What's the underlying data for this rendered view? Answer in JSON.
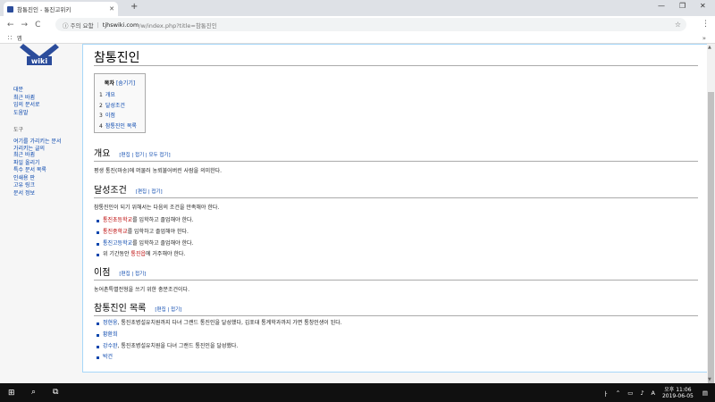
{
  "browser": {
    "tab_title": "참통진인 - 통진고위키",
    "tab_close": "✕",
    "new_tab": "+",
    "back": "←",
    "forward": "→",
    "reload": "C",
    "security_label": "주의 요함",
    "url_host": "tjhswiki.com",
    "url_path": "/w/index.php?title=참통진인",
    "bookmark_apps": "앱",
    "minimize": "—",
    "maximize": "❐",
    "close": "✕"
  },
  "sidebar": {
    "nav": [
      "대문",
      "최근 바뀜",
      "임의 문서로",
      "도움말"
    ],
    "tools_heading": "도구",
    "tools": [
      "여기를 가리키는 문서",
      "가리키는 글의 최근 바뀜",
      "파일 올리기",
      "특수 문서 목록",
      "인쇄용 판",
      "고유 링크",
      "문서 정보"
    ]
  },
  "page": {
    "title": "참통진인",
    "toc": {
      "title": "목차",
      "toggle": "[숨기기]",
      "items": [
        {
          "num": "1",
          "label": "개요"
        },
        {
          "num": "2",
          "label": "달성조건"
        },
        {
          "num": "3",
          "label": "이점"
        },
        {
          "num": "4",
          "label": "참통진인 목록"
        }
      ]
    },
    "sections": {
      "overview": {
        "heading": "개요",
        "edit": "[편집 | 접기 | 모두 접기]",
        "text": "평생 통진(마송)에 머물러 농뢰불어버린 사람을 의미한다."
      },
      "conditions": {
        "heading": "달성조건",
        "edit": "[편집 | 접기]",
        "intro": "참통진인이 되기 위해서는 다음의 조건을 만족해야 한다.",
        "items": [
          {
            "link": "통진초등학교",
            "rest": "를 입학하고 졸업해야 한다."
          },
          {
            "link": "통진중학교",
            "rest": "를 입학하고 졸업해야 한다."
          },
          {
            "link": "통진고등학교",
            "rest": "를 입학하고 졸업해야 한다."
          },
          {
            "pre": "위 기간동안 ",
            "link": "통진읍",
            "rest": "에 거주해야 한다."
          }
        ]
      },
      "benefits": {
        "heading": "이점",
        "edit": "[편집 | 접기]",
        "text": "농어촌특별전형을 쓰기 위한 충분조건이다."
      },
      "list": {
        "heading": "참통진인 목록",
        "edit": "[편집 | 접기]",
        "items": [
          {
            "link": "정현웅",
            "rest": ", 통진초병설유치원까지 다녀 그랜드 통진인을 달성했다, 김포대 통계학과까지 가면 통창인생이 된다."
          },
          {
            "link": "황환희",
            "rest": ""
          },
          {
            "link": "강수완",
            "rest": ", 통진초병설유치원을 다녀 그랜드 통진인을 달성했다."
          },
          {
            "link": "박건",
            "rest": ""
          }
        ]
      }
    }
  },
  "taskbar": {
    "tray_text": "ㅏ",
    "ime": "A",
    "time": "오후 11:06",
    "date": "2019-06-05"
  }
}
